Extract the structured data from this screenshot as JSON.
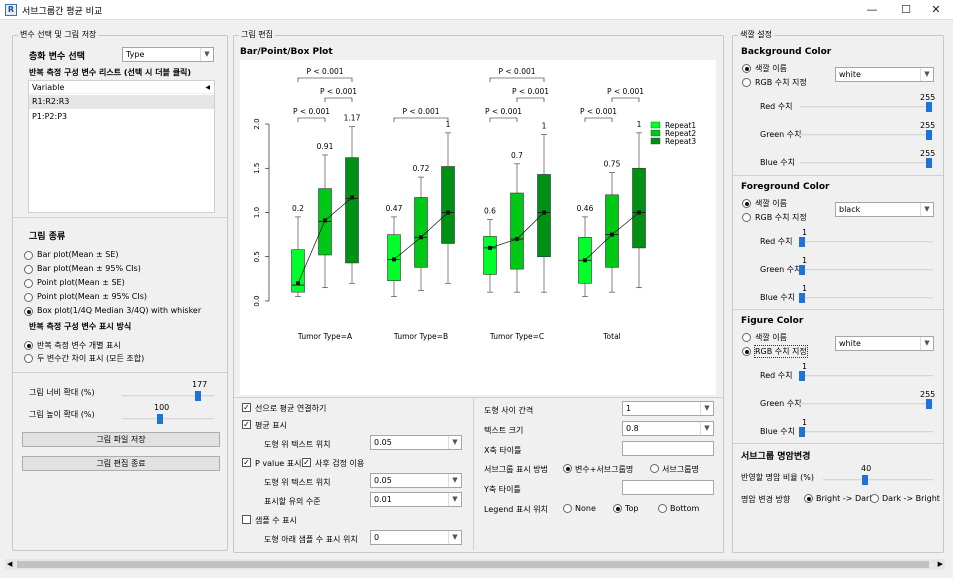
{
  "window": {
    "title": "서브그룹간 평균 비교",
    "minimize": "—",
    "maximize": "☐",
    "close": "✕"
  },
  "left": {
    "group_title": "변수 선택 및 그림 저장",
    "group_var_label": "층화 변수 선택",
    "group_var_value": "Type",
    "repeat_list_label": "반복 측정 구성 변수 리스트 (선택 시 더블 클릭)",
    "list_header": "Variable",
    "list_items": [
      "R1:R2:R3",
      "P1:P2:P3"
    ],
    "plot_type_label": "그림 종류",
    "plot_types": [
      "Bar plot(Mean ± SE)",
      "Bar plot(Mean ± 95% CIs)",
      "Point plot(Mean ± SE)",
      "Point plot(Mean ± 95% CIs)",
      "Box plot(1/4Q Median 3/4Q) with whisker"
    ],
    "display_label": "반복 측정 구성 변수 표시 방식",
    "display_opts": [
      "반복 측정 변수 개별 표시",
      "두 변수간 차이 표시 (모든 조합)"
    ],
    "width_label": "그림 너비 확대 (%)",
    "width_value": "177",
    "height_label": "그림 높이 확대 (%)",
    "height_value": "100",
    "save_button": "그림 파일 저장",
    "exit_button": "그림 편집 종료"
  },
  "middle": {
    "group_title": "그림 편집",
    "plot_title": "Bar/Point/Box Plot",
    "connect_label": "선으로 평균 연결하기",
    "mean_label": "평균 표시",
    "mean_pos_label": "도형 위 텍스트 위치",
    "mean_pos_value": "0.05",
    "pvalue_label": "P value 표시",
    "posthoc_label": "사후 검정 이용",
    "p_pos_label": "도형 위 텍스트 위치",
    "p_pos_value": "0.05",
    "sig_label": "표시할 유의 수준",
    "sig_value": "0.01",
    "n_label": "샘플 수 표시",
    "n_pos_label": "도형 아래 샘플 수 표시 위치",
    "n_pos_value": "0",
    "gap_label": "도형 사이 간격",
    "gap_value": "1",
    "text_size_label": "텍스트 크기",
    "text_size_value": "0.8",
    "xtitle_label": "X축 타이틀",
    "subgroup_label": "서브그룹 표시 방법",
    "subgroup_opts": [
      "변수+서브그룹명",
      "서브그룹명"
    ],
    "ytitle_label": "Y축 타이틀",
    "legend_label": "Legend 표시 위치",
    "legend_opts": [
      "None",
      "Top",
      "Bottom"
    ]
  },
  "right": {
    "group_title": "색깔 설정",
    "bg": {
      "title": "Background Color",
      "opt1": "색깔 이름",
      "opt2": "RGB 수치 지정",
      "combo": "white",
      "red_label": "Red 수치",
      "red": "255",
      "green_label": "Green 수치",
      "green": "255",
      "blue_label": "Blue 수치",
      "blue": "255"
    },
    "fg": {
      "title": "Foreground Color",
      "opt1": "색깔 이름",
      "opt2": "RGB 수치 지정",
      "combo": "black",
      "red_label": "Red 수치",
      "red": "1",
      "green_label": "Green 수치",
      "green": "1",
      "blue_label": "Blue 수치",
      "blue": "1"
    },
    "fig": {
      "title": "Figure Color",
      "opt1": "색깔 이름",
      "opt2": "RGB 수치 지정",
      "combo": "white",
      "red_label": "Red 수치",
      "red": "1",
      "green_label": "Green 수치",
      "green": "255",
      "blue_label": "Blue 수치",
      "blue": "1"
    },
    "bright": {
      "title": "서브그룹 명암변경",
      "ratio_label": "반영할 명암 비율 (%)",
      "ratio": "40",
      "dir_label": "명암 변경 방향",
      "opt1": "Bright -> Dark",
      "opt2": "Dark -> Bright"
    }
  },
  "chart_data": {
    "type": "box",
    "categories": [
      "Tumor Type=A",
      "Tumor Type=B",
      "Tumor Type=C",
      "Total"
    ],
    "series": [
      {
        "name": "Repeat1",
        "color": "#00ff2a"
      },
      {
        "name": "Repeat2",
        "color": "#00c817"
      },
      {
        "name": "Repeat3",
        "color": "#009114"
      }
    ],
    "yticks": [
      "0.0",
      "0.5",
      "1.0",
      "1.5",
      "2.0"
    ],
    "ylim": [
      0,
      2.0
    ],
    "boxes": [
      [
        {
          "wlo": 0.05,
          "q1": 0.1,
          "med": 0.18,
          "q3": 0.58,
          "whi": 0.95,
          "mean": 0.2,
          "label": "0.2"
        },
        {
          "wlo": 0.15,
          "q1": 0.52,
          "med": 0.9,
          "q3": 1.27,
          "whi": 1.65,
          "mean": 0.91,
          "label": "0.91"
        },
        {
          "wlo": 0.2,
          "q1": 0.43,
          "med": 1.16,
          "q3": 1.62,
          "whi": 1.97,
          "mean": 1.17,
          "label": "1.17"
        }
      ],
      [
        {
          "wlo": 0.05,
          "q1": 0.23,
          "med": 0.47,
          "q3": 0.75,
          "whi": 0.95,
          "mean": 0.47,
          "label": "0.47"
        },
        {
          "wlo": 0.12,
          "q1": 0.38,
          "med": 0.72,
          "q3": 1.17,
          "whi": 1.4,
          "mean": 0.72,
          "label": "0.72"
        },
        {
          "wlo": 0.2,
          "q1": 0.65,
          "med": 1.0,
          "q3": 1.52,
          "whi": 1.9,
          "mean": 1.0,
          "label": "1"
        }
      ],
      [
        {
          "wlo": 0.1,
          "q1": 0.3,
          "med": 0.6,
          "q3": 0.73,
          "whi": 0.92,
          "mean": 0.6,
          "label": "0.6"
        },
        {
          "wlo": 0.1,
          "q1": 0.36,
          "med": 0.7,
          "q3": 1.22,
          "whi": 1.55,
          "mean": 0.7,
          "label": "0.7"
        },
        {
          "wlo": 0.1,
          "q1": 0.5,
          "med": 1.0,
          "q3": 1.43,
          "whi": 1.88,
          "mean": 1.0,
          "label": "1"
        }
      ],
      [
        {
          "wlo": 0.05,
          "q1": 0.2,
          "med": 0.46,
          "q3": 0.72,
          "whi": 0.95,
          "mean": 0.46,
          "label": "0.46"
        },
        {
          "wlo": 0.1,
          "q1": 0.38,
          "med": 0.75,
          "q3": 1.2,
          "whi": 1.45,
          "mean": 0.75,
          "label": "0.75"
        },
        {
          "wlo": 0.15,
          "q1": 0.6,
          "med": 1.0,
          "q3": 1.5,
          "whi": 1.9,
          "mean": 1.0,
          "label": "1"
        }
      ]
    ],
    "pvalues": [
      {
        "cat": 0,
        "from": 0,
        "to": 1,
        "level": 1,
        "text": "P < 0.001"
      },
      {
        "cat": 0,
        "from": 1,
        "to": 2,
        "level": 2,
        "text": "P < 0.001"
      },
      {
        "cat": 0,
        "from": 0,
        "to": 2,
        "level": 3,
        "text": "P < 0.001"
      },
      {
        "cat": 1,
        "from": 0,
        "to": 2,
        "level": 1,
        "text": "P < 0.001"
      },
      {
        "cat": 2,
        "from": 0,
        "to": 1,
        "level": 1,
        "text": "P < 0.001"
      },
      {
        "cat": 2,
        "from": 1,
        "to": 2,
        "level": 2,
        "text": "P < 0.001"
      },
      {
        "cat": 2,
        "from": 0,
        "to": 2,
        "level": 3,
        "text": "P < 0.001"
      },
      {
        "cat": 3,
        "from": 0,
        "to": 1,
        "level": 1,
        "text": "P < 0.001"
      },
      {
        "cat": 3,
        "from": 1,
        "to": 2,
        "level": 2,
        "text": "P < 0.001"
      }
    ]
  }
}
